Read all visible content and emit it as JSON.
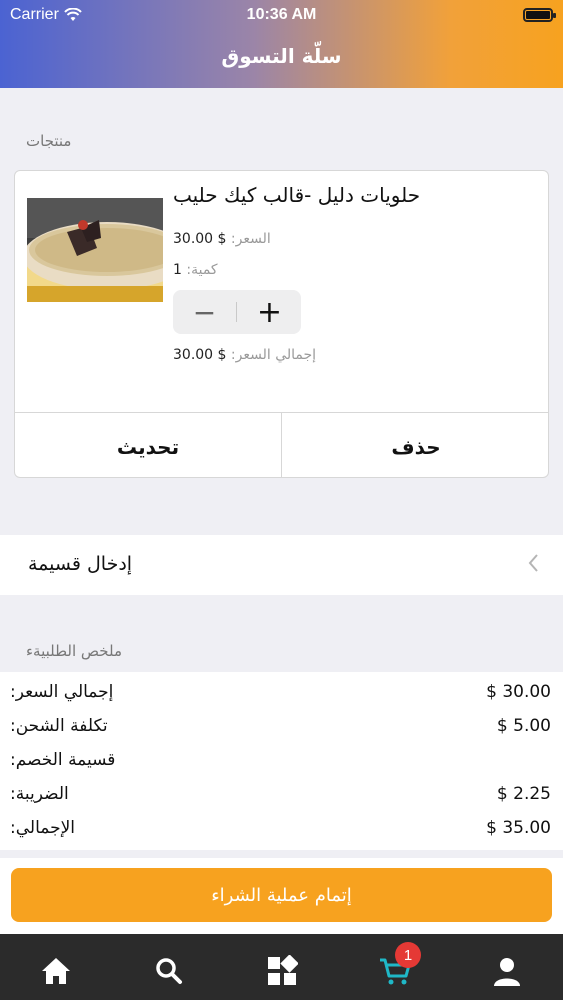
{
  "status_bar": {
    "carrier": "Carrier",
    "time": "10:36 AM",
    "battery_level": 1.0
  },
  "header": {
    "title": "سلّة التسوق",
    "gradient_colors": [
      "#4b63d2",
      "#f7a21f"
    ]
  },
  "products_section": {
    "label": "منتجات",
    "items": [
      {
        "name": "حلويات دليل -قالب كيك حليب",
        "price_label": "السعر:",
        "price_value": "$ 30.00",
        "quantity_label": "كمية:",
        "quantity_value": "1",
        "total_label": "إجمالي السعر:",
        "total_value": "$ 30.00",
        "image": "cake-image"
      }
    ],
    "stepper": {
      "minus": "−",
      "plus": "+"
    },
    "update_label": "تحديث",
    "delete_label": "حذف"
  },
  "coupon": {
    "label": "إدخال قسيمة",
    "icon": "chevron-left-icon"
  },
  "summary": {
    "label": "ملخص الطلبيةء",
    "rows": [
      {
        "label": "إجمالي السعر:",
        "value": "$ 30.00"
      },
      {
        "label": "تكلفة الشحن:",
        "value": "$ 5.00"
      },
      {
        "label": "قسيمة الخصم:",
        "value": ""
      },
      {
        "label": "الضريبة:",
        "value": "$ 2.25"
      },
      {
        "label": "الإجمالي:",
        "value": "$ 35.00"
      }
    ]
  },
  "checkout": {
    "label": "إتمام عملية الشراء",
    "color": "#f7a21f"
  },
  "tab_bar": {
    "background": "#2b2b2b",
    "active_color": "#1fb8c7",
    "tabs": [
      {
        "icon": "home-icon"
      },
      {
        "icon": "search-icon"
      },
      {
        "icon": "categories-icon"
      },
      {
        "icon": "cart-icon",
        "badge": "1"
      },
      {
        "icon": "profile-icon"
      }
    ]
  }
}
